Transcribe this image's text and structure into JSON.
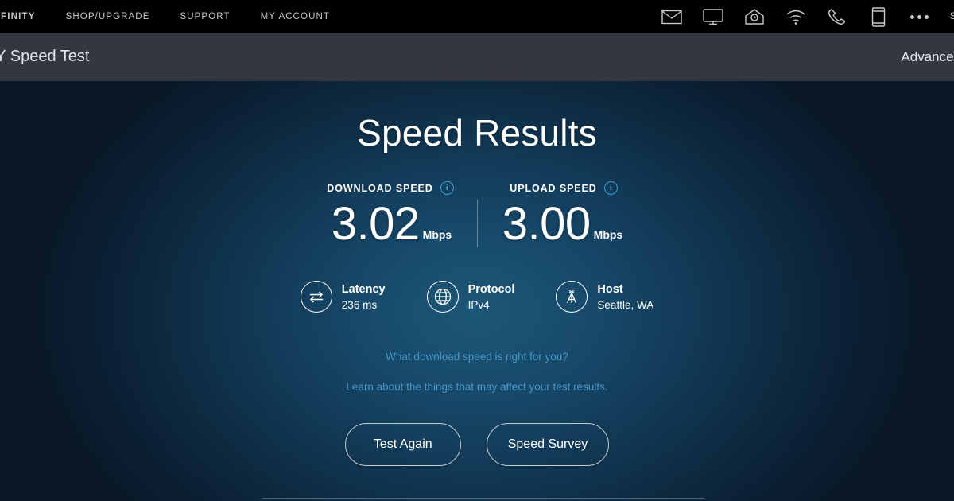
{
  "topnav": {
    "links": [
      {
        "label": "FINITY",
        "name": "xfinity-brand-link"
      },
      {
        "label": "SHOP/UPGRADE",
        "name": "shop-upgrade-link"
      },
      {
        "label": "SUPPORT",
        "name": "support-link"
      },
      {
        "label": "MY ACCOUNT",
        "name": "my-account-link"
      }
    ],
    "icons": [
      "mail-icon",
      "tv-icon",
      "home-security-icon",
      "wifi-icon",
      "phone-icon",
      "mobile-icon",
      "more-options-icon"
    ],
    "signin_label": "SIGN I"
  },
  "appbar": {
    "title": "NITY Speed Test",
    "advanced_settings_label": "Advanced Sett"
  },
  "main": {
    "page_title": "Speed Results",
    "download": {
      "label": "DOWNLOAD SPEED",
      "value": "3.02",
      "unit": "Mbps",
      "info_glyph": "i"
    },
    "upload": {
      "label": "UPLOAD SPEED",
      "value": "3.00",
      "unit": "Mbps",
      "info_glyph": "i"
    },
    "metrics": [
      {
        "name": "Latency",
        "value": "236 ms",
        "icon": "latency-arrows-icon"
      },
      {
        "name": "Protocol",
        "value": "IPv4",
        "icon": "globe-icon"
      },
      {
        "name": "Host",
        "value": "Seattle, WA",
        "icon": "broadcast-tower-icon"
      }
    ],
    "links": {
      "primary": "What download speed is right for you?",
      "secondary": "Learn about the things that may affect your test results."
    },
    "buttons": {
      "test_again": "Test Again",
      "speed_survey": "Speed Survey"
    }
  },
  "colors": {
    "topnav_bg": "#000000",
    "appbar_bg": "#33373f",
    "stage_center": "#1d5777",
    "stage_edge": "#0a1828",
    "link_blue": "#4a96c8",
    "info_blue": "#3f9fd4",
    "text_white": "#ffffff"
  }
}
